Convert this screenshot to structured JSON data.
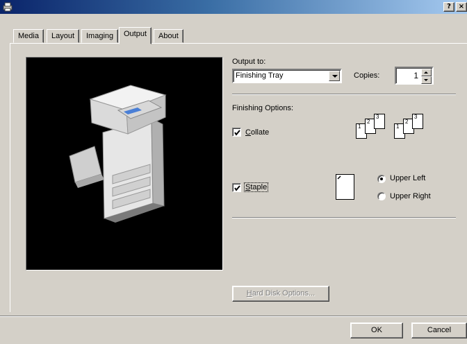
{
  "window": {
    "help_button": "?",
    "close_button": "×"
  },
  "tabs": [
    {
      "label": "Media"
    },
    {
      "label": "Layout"
    },
    {
      "label": "Imaging"
    },
    {
      "label": "Output",
      "active": true
    },
    {
      "label": "About"
    }
  ],
  "output": {
    "output_to_label": "Output to:",
    "output_to_value": "Finishing Tray",
    "copies_label": "Copies:",
    "copies_value": "1"
  },
  "finishing": {
    "label": "Finishing Options:",
    "collate_label": "Collate",
    "collate_checked": true,
    "collate_pages_a": [
      "1",
      "2",
      "3"
    ],
    "collate_pages_b": [
      "1",
      "2",
      "3"
    ],
    "staple_label": "Staple",
    "staple_checked": true,
    "staple_positions": [
      {
        "label": "Upper Left",
        "selected": true
      },
      {
        "label": "Upper Right",
        "selected": false
      }
    ]
  },
  "hard_disk_button": "Hard Disk Options...",
  "footer": {
    "ok_label": "OK",
    "cancel_label": "Cancel"
  },
  "colors": {
    "title_gradient_start": "#0a246a",
    "title_gradient_end": "#a6caf0",
    "face": "#d4d0c8",
    "preview_bg": "#000000"
  }
}
